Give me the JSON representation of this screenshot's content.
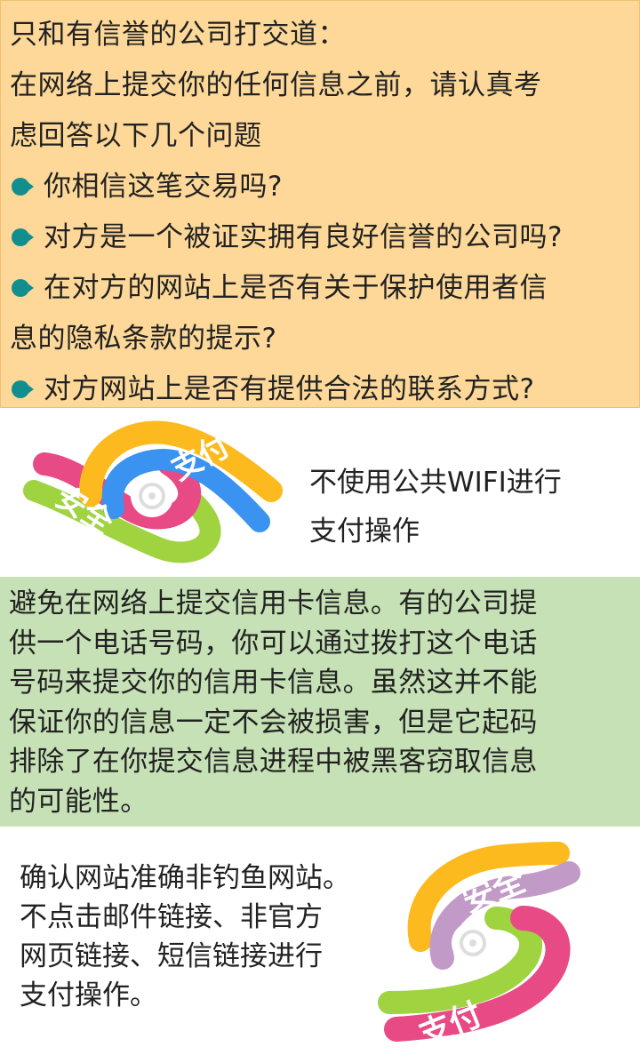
{
  "intro": {
    "title": "只和有信誉的公司打交道：",
    "lead_line1": "在网络上提交你的任何信息之前，请认真考",
    "lead_line2": "虑回答以下几个问题",
    "q1": "你相信这笔交易吗?",
    "q2": "对方是一个被证实拥有良好信誉的公司吗?",
    "q3_line1": "在对方的网站上是否有关于保护使用者信",
    "q3_line2": "息的隐私条款的提示?",
    "q4": "对方网站上是否有提供合法的联系方式?"
  },
  "wifi": {
    "logo_text_top": "支付",
    "logo_text_bottom": "安全",
    "line1": "不使用公共WIFI进行",
    "line2": "支付操作"
  },
  "credit": {
    "lines": [
      "避免在网络上提交信用卡信息。有的公司提",
      "供一个电话号码，你可以通过拨打这个电话",
      "号码来提交你的信用卡信息。虽然这并不能",
      "保证你的信息一定不会被损害，但是它起码",
      "排除了在你提交信息进程中被黑客窃取信息",
      "的可能性。"
    ]
  },
  "phishing": {
    "lines": [
      "确认网站准确非钓鱼网站。",
      "不点击邮件链接、非官方",
      "网页链接、短信链接进行",
      "支付操作。"
    ],
    "logo_text_top": "安全",
    "logo_text_bottom": "支付"
  },
  "colors": {
    "orange_panel": "#fdd898",
    "green_panel": "#c7e1b6",
    "bullet": "#138e8e",
    "logo_yellow": "#fdba1f",
    "logo_blue": "#3a93f0",
    "logo_pink": "#e84a86",
    "logo_green": "#9fd33f",
    "logo_purple": "#c29ac8"
  }
}
